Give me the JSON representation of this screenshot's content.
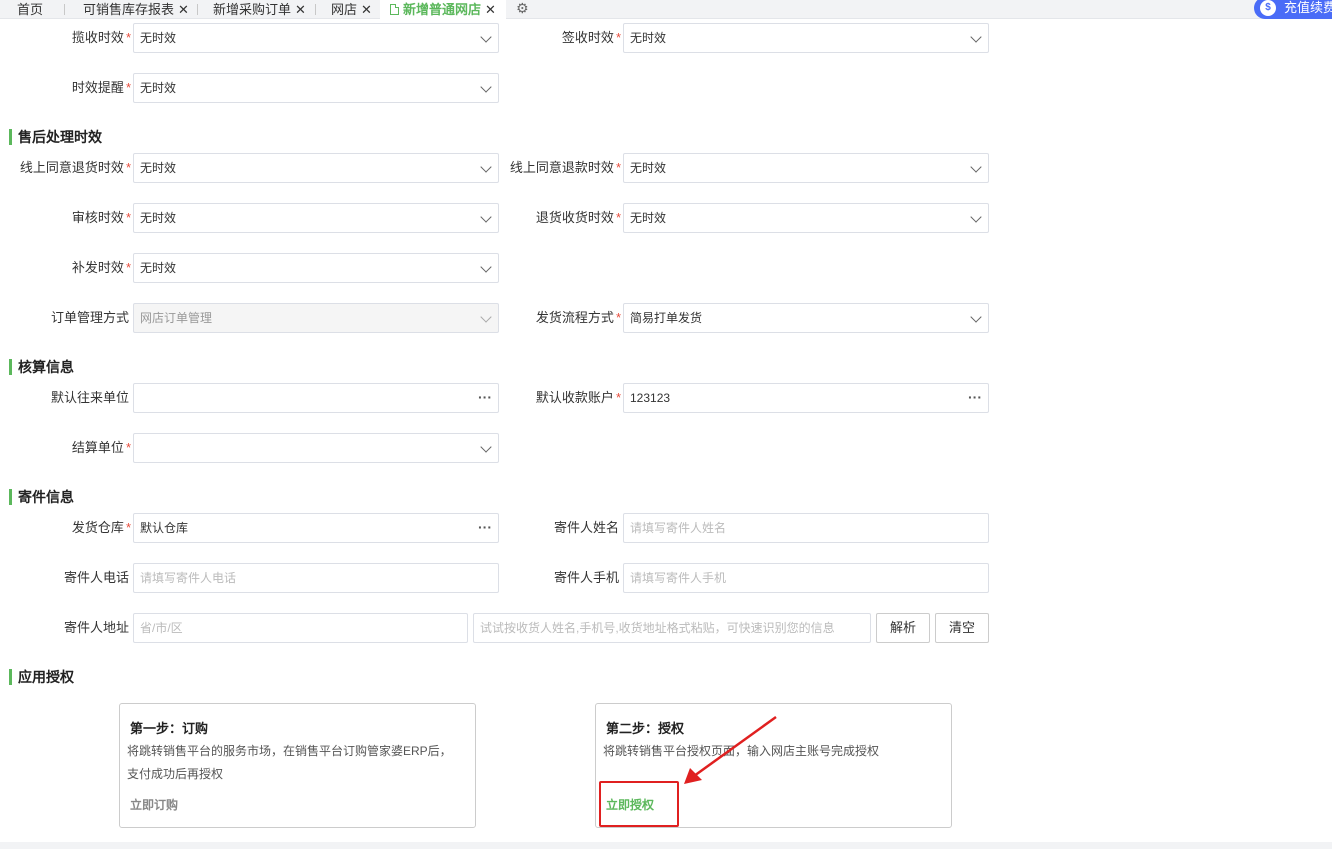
{
  "tabs": {
    "home": "首页",
    "t1": "可销售库存报表",
    "t2": "新增采购订单",
    "t3": "网店",
    "t4": "新增普通网店",
    "close": "✕",
    "recharge": "充值续费"
  },
  "form": {
    "lanshou_label": "揽收时效",
    "lanshou_value": "无时效",
    "qianshou_label": "签收时效",
    "qianshou_value": "无时效",
    "tixing_label": "时效提醒",
    "tixing_value": "无时效",
    "aftersale_title": "售后处理时效",
    "tuihuo_label": "线上同意退货时效",
    "tuihuo_value": "无时效",
    "tuikuan_label": "线上同意退款时效",
    "tuikuan_value": "无时效",
    "shenhe_label": "审核时效",
    "shenhe_value": "无时效",
    "tuihuoshouhuo_label": "退货收货时效",
    "tuihuoshouhuo_value": "无时效",
    "bufa_label": "补发时效",
    "bufa_value": "无时效",
    "order_mgmt_label": "订单管理方式",
    "order_mgmt_value": "网店订单管理",
    "ship_flow_label": "发货流程方式",
    "ship_flow_value": "简易打单发货",
    "accounting_title": "核算信息",
    "default_unit_label": "默认往来单位",
    "default_unit_value": "",
    "default_account_label": "默认收款账户",
    "default_account_value": "123123",
    "settle_label": "结算单位",
    "settle_value": "",
    "sender_title": "寄件信息",
    "warehouse_label": "发货仓库",
    "warehouse_value": "默认仓库",
    "sender_name_label": "寄件人姓名",
    "sender_name_ph": "请填写寄件人姓名",
    "sender_tel_label": "寄件人电话",
    "sender_tel_ph": "请填写寄件人电话",
    "sender_mobile_label": "寄件人手机",
    "sender_mobile_ph": "请填写寄件人手机",
    "sender_addr_label": "寄件人地址",
    "sender_addr_ph": "省/市/区",
    "paste_ph": "试试按收货人姓名,手机号,收货地址格式粘贴，可快速识别您的信息",
    "parse_btn": "解析",
    "clear_btn": "清空",
    "auth_title": "应用授权"
  },
  "cards": {
    "step1_title": "第一步：订购",
    "step1_desc": "将跳转销售平台的服务市场，在销售平台订购管家婆ERP后，支付成功后再授权",
    "step1_link": "立即订购",
    "step2_title": "第二步：授权",
    "step2_desc": "将跳转销售平台授权页面，输入网店主账号完成授权",
    "step2_link": "立即授权"
  },
  "required_mark": "*",
  "colors": {
    "accent": "#5cb85c",
    "required": "#e74c3c",
    "annotation": "#e02020",
    "recharge": "#4a6cf7"
  }
}
